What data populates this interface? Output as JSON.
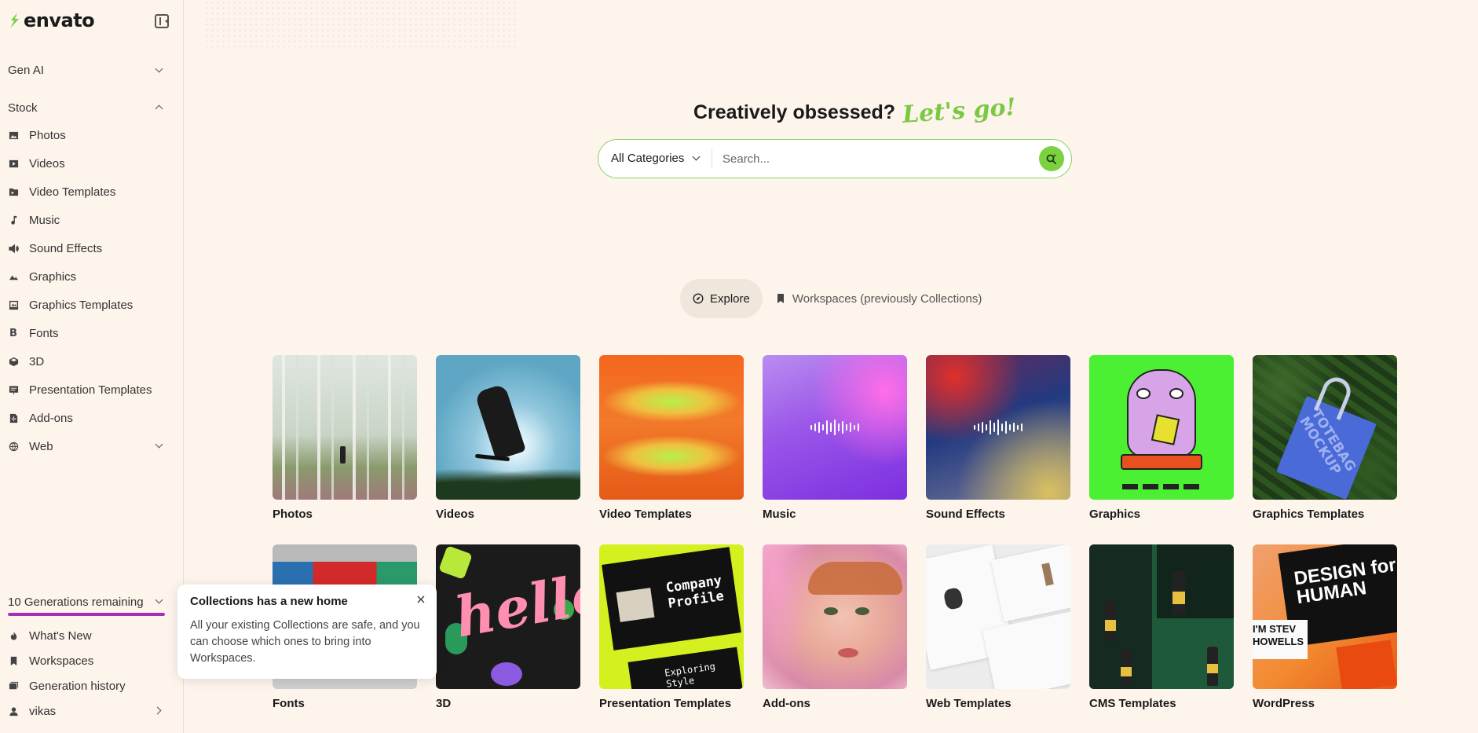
{
  "brand": {
    "name": "envato",
    "accent": "#7bd13f"
  },
  "sidebar": {
    "sections": [
      {
        "label": "Gen AI",
        "state": "collapsed"
      },
      {
        "label": "Stock",
        "state": "expanded"
      }
    ],
    "items": [
      {
        "label": "Photos",
        "icon": "photo-icon"
      },
      {
        "label": "Videos",
        "icon": "video-icon"
      },
      {
        "label": "Video Templates",
        "icon": "video-template-icon"
      },
      {
        "label": "Music",
        "icon": "music-note-icon"
      },
      {
        "label": "Sound Effects",
        "icon": "speaker-icon"
      },
      {
        "label": "Graphics",
        "icon": "mountain-icon"
      },
      {
        "label": "Graphics Templates",
        "icon": "graphics-template-icon"
      },
      {
        "label": "Fonts",
        "icon": "font-icon"
      },
      {
        "label": "3D",
        "icon": "cube-icon"
      },
      {
        "label": "Presentation Templates",
        "icon": "presentation-icon"
      },
      {
        "label": "Add-ons",
        "icon": "addon-icon"
      },
      {
        "label": "Web",
        "icon": "globe-icon"
      }
    ],
    "generations": {
      "label": "10 Generations remaining",
      "progress": 1.0
    },
    "bottom": [
      {
        "label": "What's New",
        "icon": "flame-icon"
      },
      {
        "label": "Workspaces",
        "icon": "bookmark-icon"
      },
      {
        "label": "Generation history",
        "icon": "history-icon"
      },
      {
        "label": "vikas",
        "icon": "user-icon"
      }
    ]
  },
  "hero": {
    "headline": "Creatively obsessed?",
    "script": "Let's go!"
  },
  "search": {
    "category": "All Categories",
    "placeholder": "Search..."
  },
  "tabs": [
    {
      "label": "Explore",
      "active": true
    },
    {
      "label": "Workspaces (previously Collections)",
      "active": false
    }
  ],
  "categories": [
    {
      "label": "Photos"
    },
    {
      "label": "Videos"
    },
    {
      "label": "Video Templates"
    },
    {
      "label": "Music"
    },
    {
      "label": "Sound Effects"
    },
    {
      "label": "Graphics"
    },
    {
      "label": "Graphics Templates"
    },
    {
      "label": "Fonts"
    },
    {
      "label": "3D"
    },
    {
      "label": "Presentation Templates"
    },
    {
      "label": "Add-ons"
    },
    {
      "label": "Web Templates"
    },
    {
      "label": "CMS Templates"
    },
    {
      "label": "WordPress"
    }
  ],
  "thumb_text": {
    "totebag": "TOTEBAG MOCKUP",
    "hello": "hello",
    "company": "Company Profile",
    "exploring": "Exploring Style",
    "design": "DESIGN for HUMAN",
    "wordpress_sub": "I'M STEV HOWELLS"
  },
  "toast": {
    "title": "Collections has a new home",
    "body": "All your existing Collections are safe, and you can choose which ones to bring into Workspaces.",
    "close": "×"
  }
}
